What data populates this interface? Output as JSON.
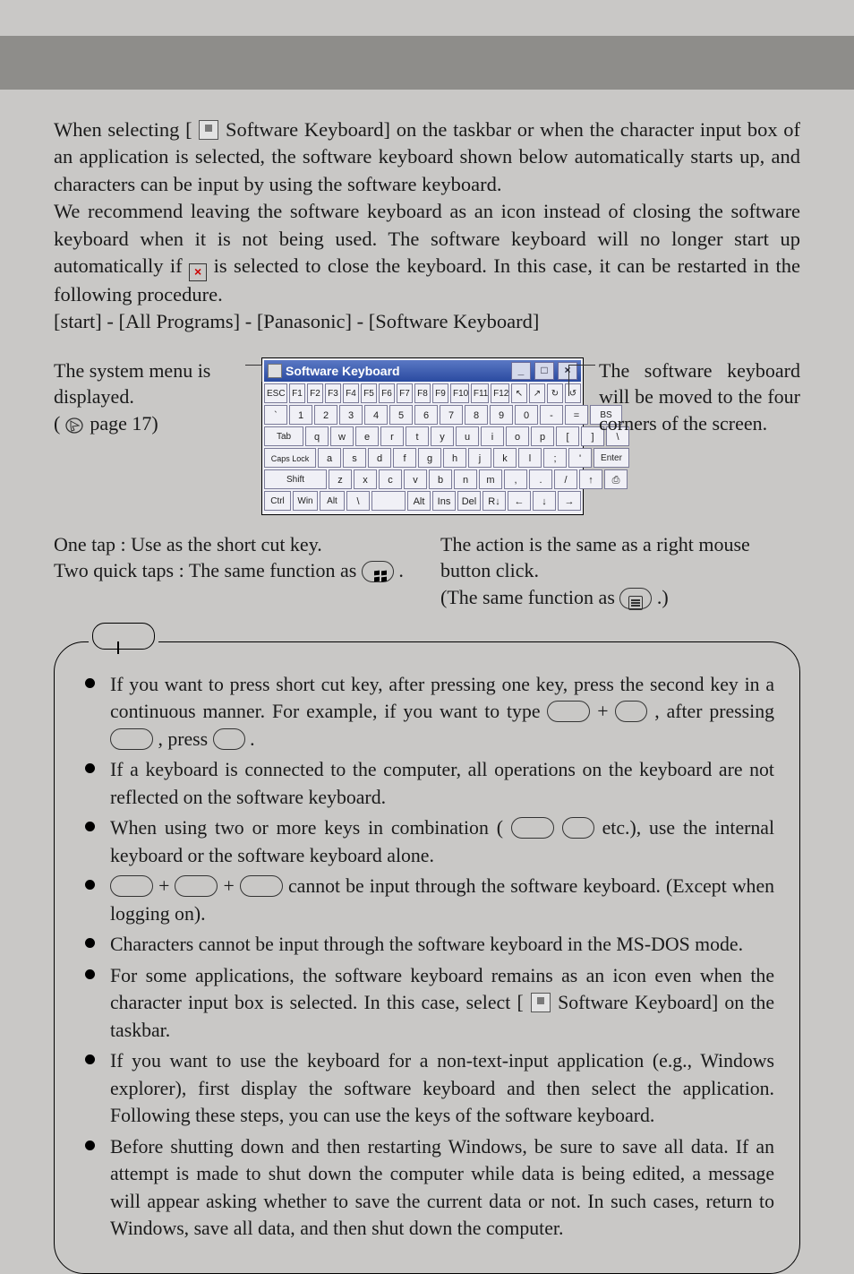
{
  "intro": {
    "p1_a": "When selecting [",
    "p1_b": " Software Keyboard] on the taskbar or when the character input box of an application is selected, the software keyboard shown below automatically starts up, and characters can be input by using the software keyboard.",
    "p2_a": "We recommend leaving the software keyboard as an icon instead of closing the software keyboard when it is not being used. The software keyboard will no longer start up automatically if ",
    "p2_b": " is selected to close the keyboard. In this case, it can be restarted in the following procedure.",
    "p3": "[start] - [All Programs] - [Panasonic] - [Software Keyboard]",
    "xglyph": "×"
  },
  "leftcaption": {
    "l1": "The system menu is displayed.",
    "l2_a": "(",
    "l2_b": " page 17)"
  },
  "rightcaption": {
    "r1": "The software keyboard will be moved to the four corners of the screen."
  },
  "keyboard": {
    "title": "Software Keyboard",
    "min": "_",
    "max": "□",
    "close": "×",
    "rows": {
      "r0": [
        "ESC",
        "F1",
        "F2",
        "F3",
        "F4",
        "F5",
        "F6",
        "F7",
        "F8",
        "F9",
        "F10",
        "F11",
        "F12"
      ],
      "r0b": [
        "↖",
        "↗",
        "↻",
        "↺"
      ],
      "r1": [
        "`",
        "1",
        "2",
        "3",
        "4",
        "5",
        "6",
        "7",
        "8",
        "9",
        "0",
        "-",
        "="
      ],
      "r1_bs": "BS",
      "r2_tab": "Tab",
      "r2": [
        "q",
        "w",
        "e",
        "r",
        "t",
        "y",
        "u",
        "i",
        "o",
        "p",
        "[",
        "]",
        "\\"
      ],
      "r3_caps": "Caps Lock",
      "r3": [
        "a",
        "s",
        "d",
        "f",
        "g",
        "h",
        "j",
        "k",
        "l",
        ";",
        "'"
      ],
      "r3_enter": "Enter",
      "r4_shift": "Shift",
      "r4": [
        "z",
        "x",
        "c",
        "v",
        "b",
        "n",
        "m",
        ",",
        ".",
        "/",
        "↑",
        "⎙"
      ],
      "r5": [
        "Ctrl",
        "Win",
        "Alt",
        "\\"
      ],
      "r5b": [
        "Alt",
        "Ins",
        "Del",
        "R↓",
        "←",
        "↓",
        "→"
      ]
    }
  },
  "below": {
    "left_l1": "One tap : Use as the short cut key.",
    "left_l2_a": "Two quick taps : The same function as ",
    "left_l2_b": " .",
    "right_l1": "The action is the same as a right mouse button click.",
    "right_l2_a": "(The same function as ",
    "right_l2_b": " .)"
  },
  "notes": {
    "n1_a": "If you want to press short cut key, after pressing one key, press the second key in a continuous manner. For example, if you want to type ",
    "n1_b": " + ",
    "n1_c": " , after pressing ",
    "n1_d": " , press ",
    "n1_e": " .",
    "n2": "If a keyboard is connected to the computer, all operations on the keyboard are not reflected on the software keyboard.",
    "n3_a": "When using two or more keys in combination (",
    "n3_b": "     ",
    "n3_c": " etc.), use the internal keyboard or the software keyboard alone.",
    "n4_a": "",
    "n4_b": " + ",
    "n4_c": " + ",
    "n4_d": " cannot be input through the software keyboard. (Except when logging on).",
    "n5": "Characters cannot be input through the software keyboard in the MS-DOS mode.",
    "n6_a": "For some applications, the software keyboard remains as an icon even when the character input box is selected.  In this case, select [",
    "n6_b": " Software Keyboard] on the taskbar.",
    "n7": "If you want to use the keyboard for a non-text-input application (e.g., Windows explorer), first display the software keyboard and then select the application. Following these steps, you can use the keys of the software keyboard.",
    "n8": "Before shutting down and then restarting Windows, be sure to save all data. If an attempt is made to shut down the computer while data is being edited, a message will appear asking whether to save the current data or not. In such cases, return to Windows, save all data, and then shut down the computer."
  }
}
